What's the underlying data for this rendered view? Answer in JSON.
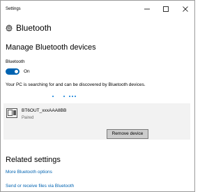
{
  "window": {
    "title": "Settings"
  },
  "header": {
    "icon": "gear-icon",
    "title": "Bluetooth"
  },
  "manage": {
    "section_title": "Manage Bluetooth devices",
    "bluetooth_label": "Bluetooth",
    "toggle_state": "On",
    "toggle_on": true,
    "accent_color": "#0063b1",
    "searching_text": "Your PC is searching for and can be discovered by Bluetooth devices."
  },
  "device": {
    "icon": "device-icon",
    "name": "BT6OUT_xxxAAA8BB",
    "status": "Paired",
    "remove_label": "Remove device"
  },
  "related": {
    "section_title": "Related settings",
    "links": [
      {
        "label": "More Bluetooth options"
      },
      {
        "label": "Send or receive files via Bluetooth"
      }
    ]
  }
}
